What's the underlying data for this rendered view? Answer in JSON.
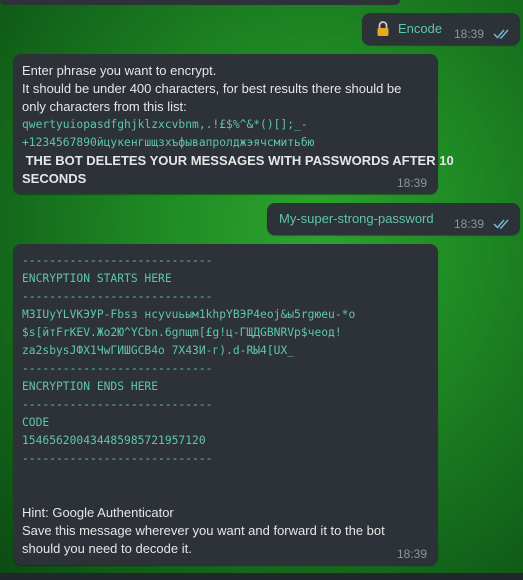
{
  "messages": {
    "encode_btn": {
      "lock_icon": "lock-icon",
      "label": "Encode",
      "time": "18:39"
    },
    "prompt": {
      "line1": "Enter phrase you want to encrypt.",
      "line2": "It should be under 400 characters, for best results there should be",
      "line3": "only characters from this list:",
      "chars1": "qwertyuiopasdfghjklzxcvbnm,.!£$%^&*()[];_-",
      "chars2": "+1234567890йцукенгшщзхъфывапролджэячсмитьбю",
      "warning1": " THE BOT DELETES YOUR MESSAGES WITH PASSWORDS AFTER 10",
      "warning2": "SECONDS",
      "time": "18:39"
    },
    "password": {
      "text": "My-super-strong-password",
      "time": "18:39"
    },
    "result": {
      "dash1": "----------------------------",
      "start": "ENCRYPTION STARTS HERE",
      "dash2": "----------------------------",
      "enc1": "МЗIUyYLVKЭУР-Fbsз нсуvuьым1khpYВЭР4eoj&ы5rgюeu-*o",
      "enc2": "$s[йтFrKEV.Жо2Ю^YCbn.6gпщm[£g!ц-ГЩДGBNRVр$чеод!",
      "enc3": "za2sbysJФX1ЧwГИШGCВ4о 7Х43И-г).d-RЫ4[UX_",
      "dash3": "----------------------------",
      "end": "ENCRYPTION ENDS HERE",
      "dash4": "----------------------------",
      "code_label": "CODE",
      "code": "154656200434485985721957120",
      "dash5": "----------------------------",
      "hint": "Hint: Google Authenticator",
      "save1": "Save this message wherever you want and forward it to the bot",
      "save2": "should you need to decode it.",
      "time": "18:39"
    }
  },
  "colors": {
    "bubble": "#2c3237",
    "accent": "#5fc7a6",
    "text": "#e6e6e6",
    "time": "#8b959e",
    "check": "#6fb9d6"
  }
}
